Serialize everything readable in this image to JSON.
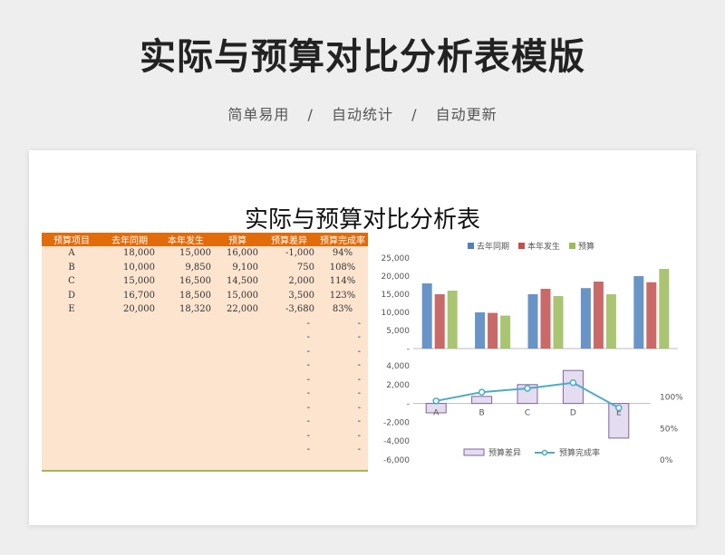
{
  "banner": {
    "title": "实际与预算对比分析表模版",
    "tags": [
      "简单易用",
      "自动统计",
      "自动更新"
    ],
    "separator": "/"
  },
  "sheet": {
    "title": "实际与预算对比分析表",
    "columns": [
      "预算项目",
      "去年同期",
      "本年发生",
      "预算",
      "预算差异",
      "预算完成率"
    ],
    "rows": [
      [
        "A",
        "18,000",
        "15,000",
        "16,000",
        "-1,000",
        "94%"
      ],
      [
        "B",
        "10,000",
        "9,850",
        "9,100",
        "750",
        "108%"
      ],
      [
        "C",
        "15,000",
        "16,500",
        "14,500",
        "2,000",
        "114%"
      ],
      [
        "D",
        "16,700",
        "18,500",
        "15,000",
        "3,500",
        "123%"
      ],
      [
        "E",
        "20,000",
        "18,320",
        "22,000",
        "-3,680",
        "83%"
      ]
    ],
    "empty_row_dash": "-",
    "empty_rows": 10
  },
  "chart_data": [
    {
      "type": "bar",
      "categories": [
        "A",
        "B",
        "C",
        "D",
        "E"
      ],
      "series": [
        {
          "name": "去年同期",
          "values": [
            18000,
            10000,
            15000,
            16700,
            20000
          ],
          "color": "#4f81bd"
        },
        {
          "name": "本年发生",
          "values": [
            15000,
            9850,
            16500,
            18500,
            18320
          ],
          "color": "#c0504d"
        },
        {
          "name": "预算",
          "values": [
            16000,
            9100,
            14500,
            15000,
            22000
          ],
          "color": "#9bbb59"
        }
      ],
      "ylim": [
        0,
        25000
      ],
      "yticks": [
        "-",
        "5,000",
        "10,000",
        "15,000",
        "20,000",
        "25,000"
      ],
      "legend": "top",
      "grid": false
    },
    {
      "type": "bar",
      "categories": [
        "A",
        "B",
        "C",
        "D",
        "E"
      ],
      "series": [
        {
          "name": "预算差异",
          "type": "bar",
          "values": [
            -1000,
            750,
            2000,
            3500,
            -3680
          ],
          "color": "#b3a2c7",
          "axis": "left"
        },
        {
          "name": "预算完成率",
          "type": "line",
          "values": [
            94,
            108,
            114,
            123,
            83
          ],
          "color": "#4bacc6",
          "axis": "right"
        }
      ],
      "ylim": [
        -6000,
        4000
      ],
      "yticks": [
        "-6,000",
        "-4,000",
        "-2,000",
        "-",
        "2,000",
        "4,000"
      ],
      "y2lim": [
        0,
        150
      ],
      "y2ticks": [
        "0%",
        "50%",
        "100%"
      ],
      "legend": "bottom"
    }
  ]
}
